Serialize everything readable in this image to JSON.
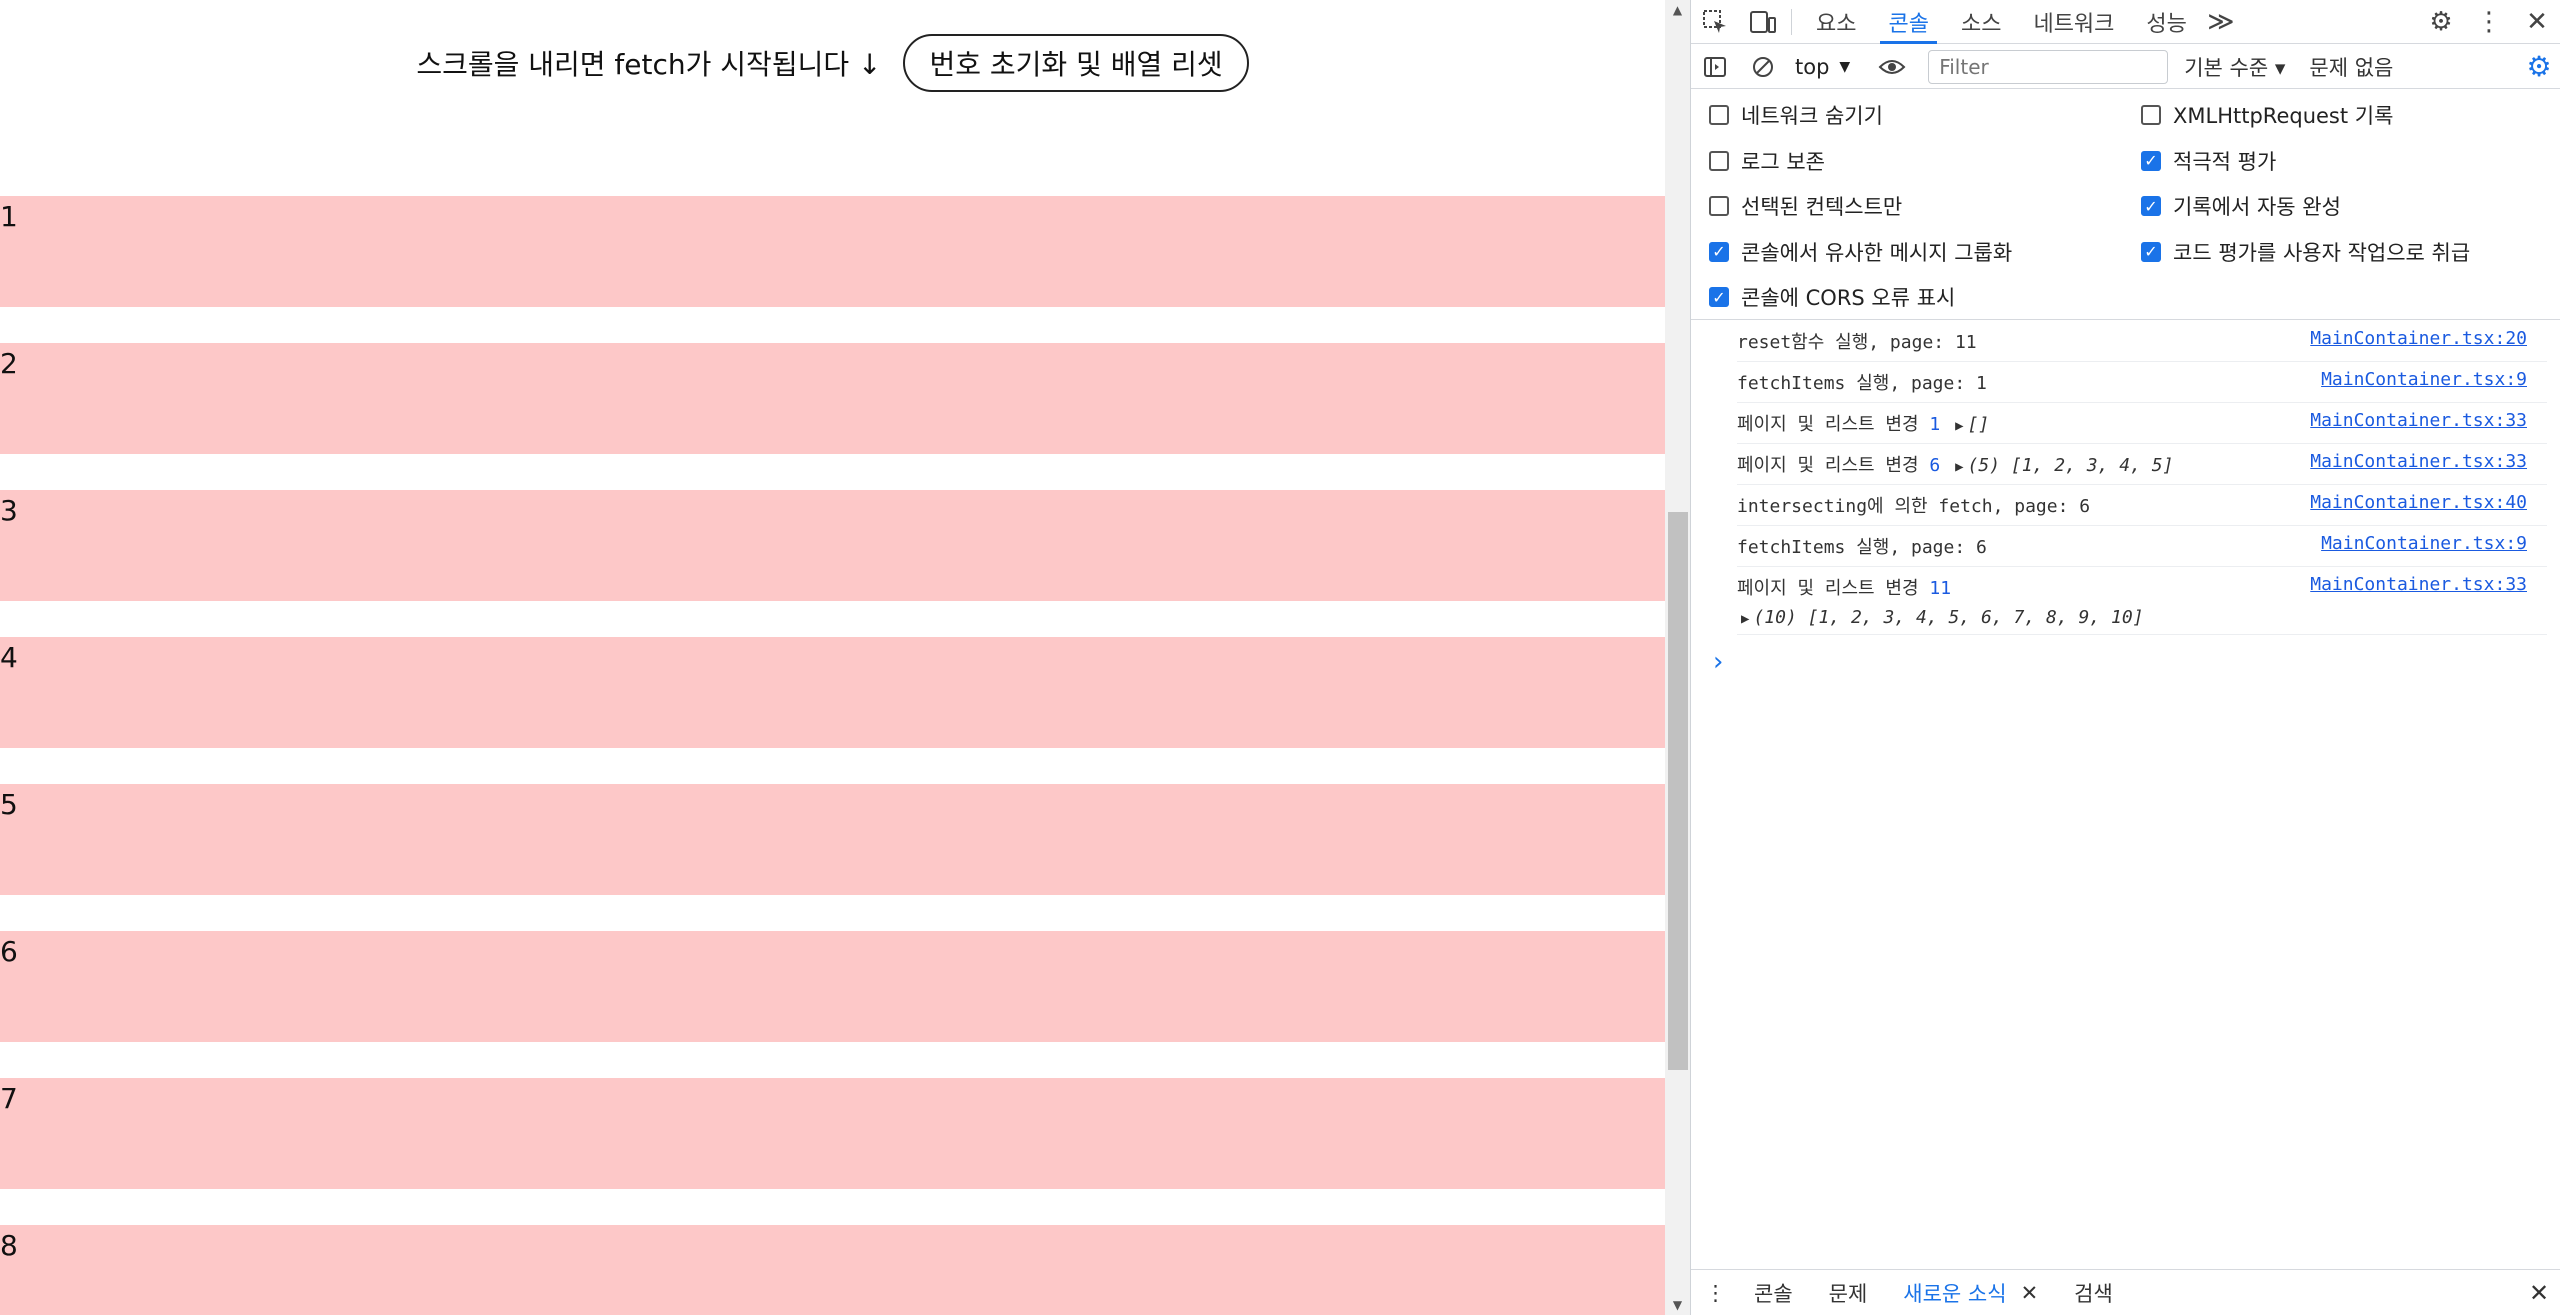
{
  "page": {
    "hint": "스크롤을 내리면 fetch가 시작됩니다 ↓",
    "reset_button": "번호 초기화 및 배열 리셋",
    "items": [
      "1",
      "2",
      "3",
      "4",
      "5",
      "6",
      "7",
      "8"
    ],
    "item_color": "#fdc8c8"
  },
  "devtools": {
    "tabs": [
      "요소",
      "콘솔",
      "소스",
      "네트워크",
      "성능"
    ],
    "active_tab": "콘솔",
    "more_tabs": "≫",
    "context": "top",
    "filter_placeholder": "Filter",
    "levels": "기본 수준 ▾",
    "issues": "문제 없음",
    "settings": {
      "left": [
        {
          "label": "네트워크 숨기기",
          "checked": false
        },
        {
          "label": "로그 보존",
          "checked": false
        },
        {
          "label": "선택된 컨텍스트만",
          "checked": false
        },
        {
          "label": "콘솔에서 유사한 메시지 그룹화",
          "checked": true
        },
        {
          "label": "콘솔에 CORS 오류 표시",
          "checked": true
        }
      ],
      "right": [
        {
          "label": "XMLHttpRequest 기록",
          "checked": false
        },
        {
          "label": "적극적 평가",
          "checked": true
        },
        {
          "label": "기록에서 자동 완성",
          "checked": true
        },
        {
          "label": "코드 평가를 사용자 작업으로 취급",
          "checked": true
        }
      ]
    },
    "console": {
      "rows": [
        {
          "text": "reset함수 실행, page: 11",
          "source": "MainContainer.tsx:20"
        },
        {
          "text": "fetchItems 실행, page: 1",
          "source": "MainContainer.tsx:9"
        },
        {
          "text": "페이지 및 리스트 변경",
          "num": "1",
          "arr": "[]",
          "source": "MainContainer.tsx:33"
        },
        {
          "text": "페이지 및 리스트 변경",
          "num": "6",
          "arr": "(5) [1, 2, 3, 4, 5]",
          "source": "MainContainer.tsx:33"
        },
        {
          "text": "intersecting에 의한 fetch, page: 6",
          "source": "MainContainer.tsx:40"
        },
        {
          "text": "fetchItems 실행, page: 6",
          "source": "MainContainer.tsx:9"
        },
        {
          "text": "페이지 및 리스트 변경",
          "num": "11",
          "arr": "(10) [1, 2, 3, 4, 5, 6, 7, 8, 9, 10]",
          "source": "MainContainer.tsx:33"
        }
      ],
      "prompt": "›"
    },
    "drawer": {
      "tabs": [
        "콘솔",
        "문제",
        "새로운 소식",
        "검색"
      ],
      "active": "새로운 소식"
    },
    "accent": "#1a73e8"
  }
}
